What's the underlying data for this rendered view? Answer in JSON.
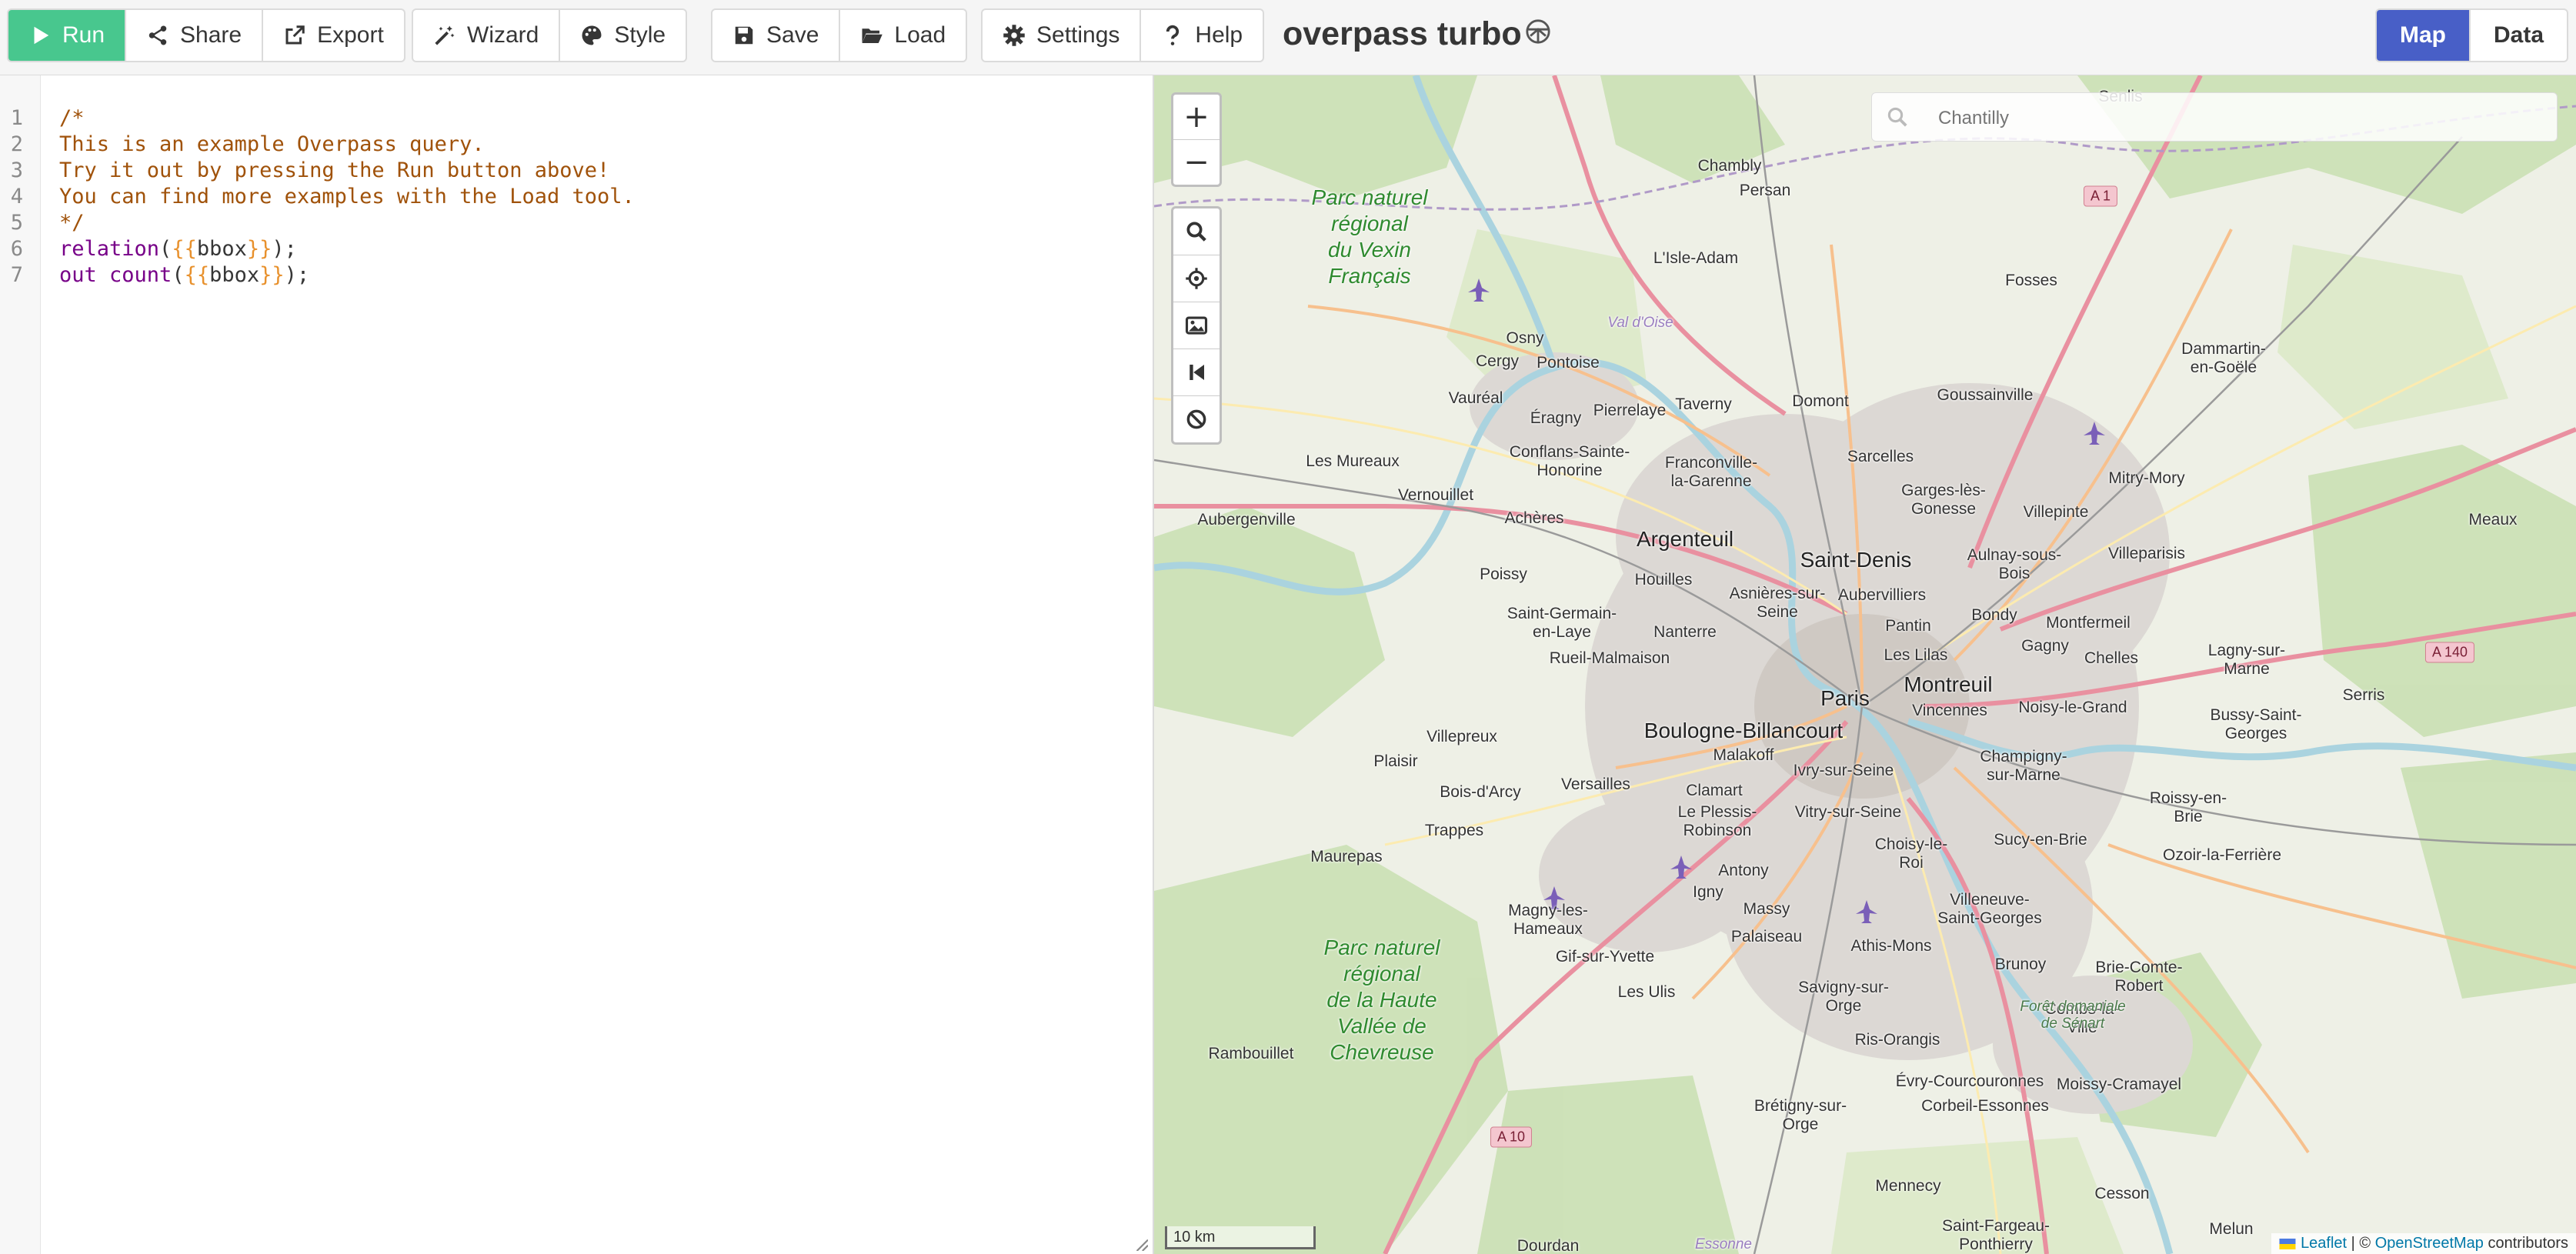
{
  "toolbar": {
    "run": "Run",
    "share": "Share",
    "export": "Export",
    "wizard": "Wizard",
    "style": "Style",
    "save": "Save",
    "load": "Load",
    "settings": "Settings",
    "help": "Help",
    "app_title": "overpass turbo",
    "view_map": "Map",
    "view_data": "Data",
    "accent_run": "#48c78e",
    "accent_view": "#485fc7"
  },
  "editor": {
    "line_numbers": [
      "1",
      "2",
      "3",
      "4",
      "5",
      "6",
      "7"
    ],
    "lines": [
      "/*",
      "This is an example Overpass query.",
      "Try it out by pressing the Run button above!",
      "You can find more examples with the Load tool.",
      "*/"
    ],
    "query_line1": {
      "kw": "relation",
      "open": "(",
      "lb": "{{",
      "arg": "bbox",
      "rb": "}}",
      "close": ");"
    },
    "query_line2": {
      "kw": "out count",
      "open": "(",
      "lb": "{{",
      "arg": "bbox",
      "rb": "}}",
      "close": ");"
    }
  },
  "map": {
    "search_placeholder": "Chantilly",
    "zoom_in": "+",
    "zoom_out": "−",
    "scale": "10 km",
    "attribution": {
      "leaflet": "Leaflet",
      "sep": " | © ",
      "osm": "OpenStreetMap",
      "suffix": " contributors"
    },
    "places": {
      "paris": "Paris",
      "saint_denis": "Saint-Denis",
      "argenteuil": "Argenteuil",
      "montreuil": "Montreuil",
      "boulogne": "Boulogne-Billancourt",
      "senlis": "Senlis",
      "chambly": "Chambly",
      "persan": "Persan",
      "lisle_adam": "L'Isle-Adam",
      "fosses": "Fosses",
      "osny": "Osny",
      "cergy": "Cergy",
      "pontoise": "Pontoise",
      "vaureal": "Vauréal",
      "eragny": "Éragny",
      "pierrelaye": "Pierrelaye",
      "taverny": "Taverny",
      "domont": "Domont",
      "goussainville": "Goussainville",
      "dammartin": "Dammartin-\nen-Goële",
      "conflans": "Conflans-Sainte-\nHonorine",
      "franconville": "Franconville-\nla-Garenne",
      "sarcelles": "Sarcelles",
      "garges": "Garges-lès-\nGonesse",
      "mitry": "Mitry-Mory",
      "les_mureaux": "Les Mureaux",
      "vernouillet": "Vernouillet",
      "aubergenville": "Aubergenville",
      "acheres": "Achères",
      "villepinte": "Villepinte",
      "meaux": "Meaux",
      "aulnay": "Aulnay-sous-\nBois",
      "villeparisis": "Villeparisis",
      "poissy": "Poissy",
      "houilles": "Houilles",
      "asnieres": "Asnières-sur-\nSeine",
      "aubervilliers": "Aubervilliers",
      "saint_germain": "Saint-Germain-\nen-Laye",
      "nanterre": "Nanterre",
      "pantin": "Pantin",
      "bondy": "Bondy",
      "montfermeil": "Montfermeil",
      "rueil": "Rueil-Malmaison",
      "les_lilas": "Les Lilas",
      "gagny": "Gagny",
      "chelles": "Chelles",
      "lagny": "Lagny-sur-\nMarne",
      "vincennes": "Vincennes",
      "noisy": "Noisy-le-Grand",
      "bussy": "Bussy-Saint-\nGeorges",
      "serris": "Serris",
      "villepreux": "Villepreux",
      "malakoff": "Malakoff",
      "ivry": "Ivry-sur-Seine",
      "champigny": "Champigny-\nsur-Marne",
      "plaisir": "Plaisir",
      "bois_darcy": "Bois-d'Arcy",
      "versailles": "Versailles",
      "clamart": "Clamart",
      "le_plessis": "Le Plessis-\nRobinson",
      "vitry": "Vitry-sur-Seine",
      "roissy": "Roissy-en-\nBrie",
      "trappes": "Trappes",
      "choisy": "Choisy-le-\nRoi",
      "sucy": "Sucy-en-Brie",
      "ozoir": "Ozoir-la-Ferrière",
      "maurepas": "Maurepas",
      "antony": "Antony",
      "igny": "Igny",
      "massy": "Massy",
      "villeneuve": "Villeneuve-\nSaint-Georges",
      "magny": "Magny-les-\nHameaux",
      "gif": "Gif-sur-Yvette",
      "palaiseau": "Palaiseau",
      "athis": "Athis-Mons",
      "brunoy": "Brunoy",
      "brie_comte": "Brie-Comte-\nRobert",
      "les_ulis": "Les Ulis",
      "savigny": "Savigny-sur-\nOrge",
      "combs": "Combs-la-\nVille",
      "rambouillet": "Rambouillet",
      "ris": "Ris-Orangis",
      "evry": "Évry-Courcouronnes",
      "moissy": "Moissy-Cramayel",
      "corbeil": "Corbeil-Essonnes",
      "bretigny": "Brétigny-sur-\nOrge",
      "mennecy": "Mennecy",
      "cesson": "Cesson",
      "melun": "Melun",
      "saint_fargeau": "Saint-Fargeau-\nPonthierry",
      "dourdan": "Dourdan"
    },
    "parks": {
      "vexin": "Parc naturel\nrégional\ndu Vexin\nFrançais",
      "chevreuse": "Parc naturel\nrégional\nde la Haute\nVallée de\nChevreuse",
      "senart": "Forêt domaniale\nde Sénart",
      "val_doise": "Val d'Oise",
      "essonne": "Essonne"
    },
    "shields": {
      "a1": "A 1",
      "a140": "A 140",
      "a10": "A 10"
    }
  }
}
